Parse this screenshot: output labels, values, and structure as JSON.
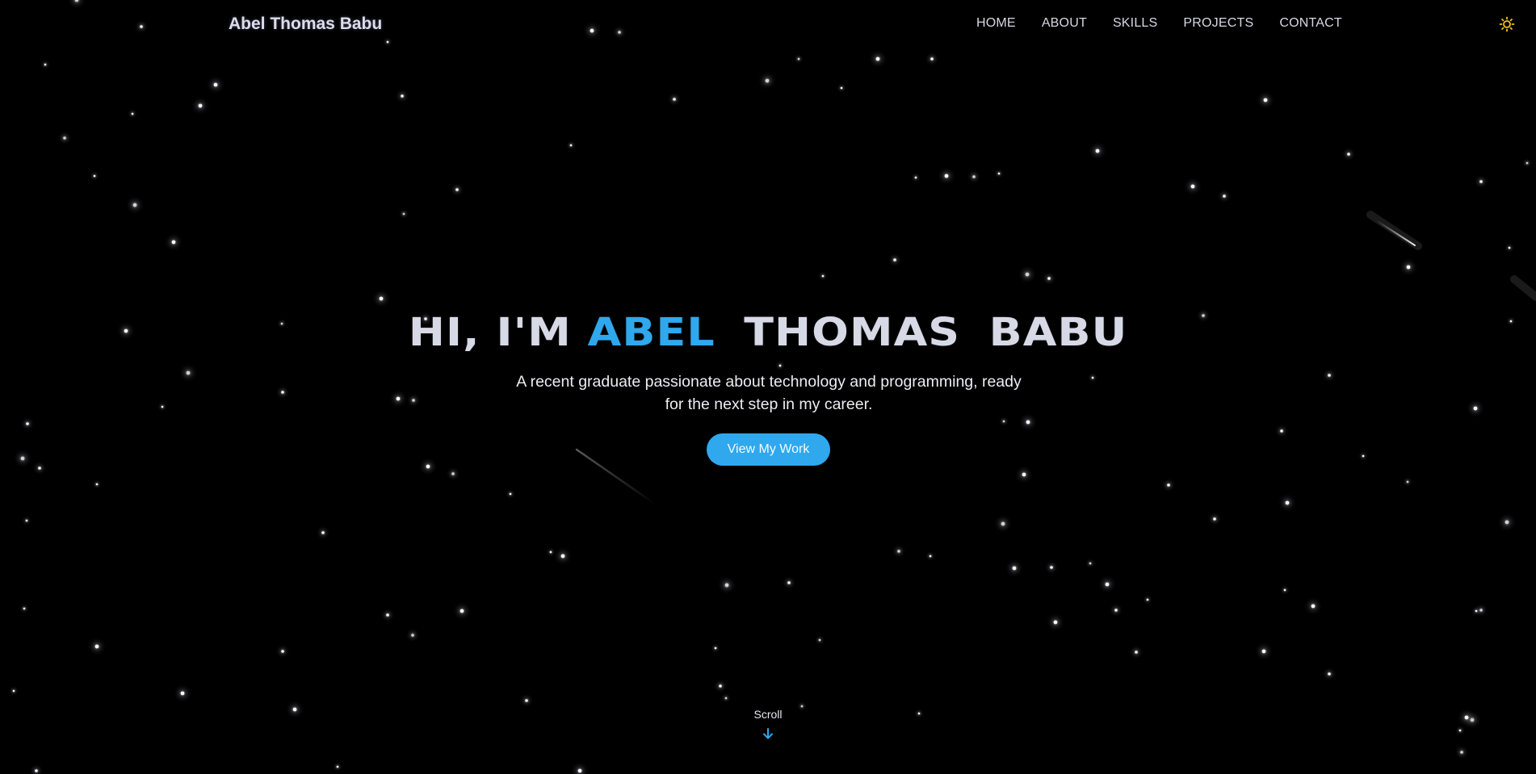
{
  "header": {
    "brand": "Abel Thomas Babu",
    "nav": [
      "HOME",
      "ABOUT",
      "SKILLS",
      "PROJECTS",
      "CONTACT"
    ],
    "theme_toggle_icon": "sun-icon"
  },
  "hero": {
    "greeting": "HI, I'M",
    "name_accent": "ABEL",
    "name_rest_1": "THOMAS",
    "name_rest_2": "BABU",
    "subtitle_line1": "A recent graduate passionate about technology and programming, ready",
    "subtitle_line2": "for the next step in my career.",
    "cta_label": "View My Work"
  },
  "scroll": {
    "label": "Scroll",
    "icon": "arrow-down-icon"
  },
  "colors": {
    "background": "#000000",
    "accent": "#2fa8ee",
    "title": "#d7dae6",
    "sun": "#f0c419"
  }
}
